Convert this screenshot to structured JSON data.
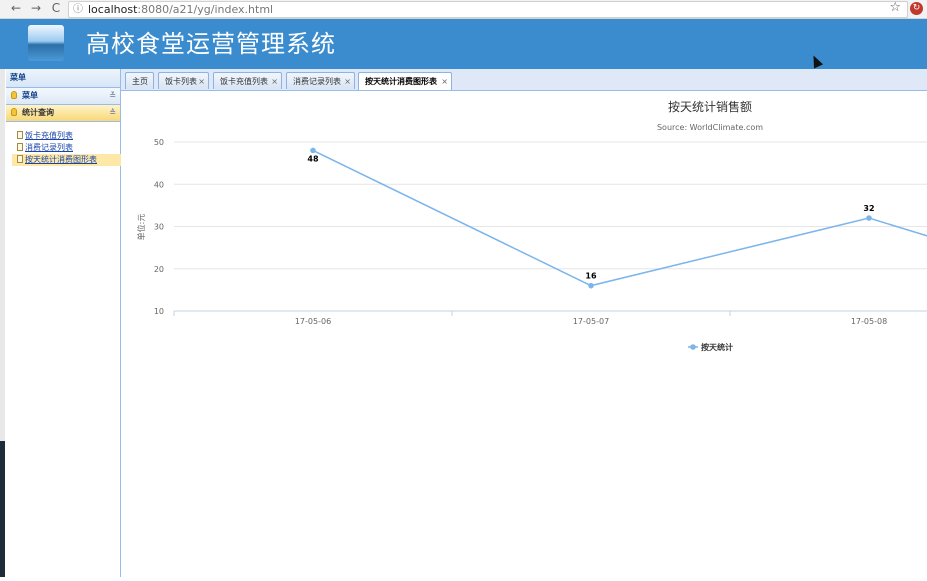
{
  "browser": {
    "url_host": "localhost",
    "url_path": ":8080/a21/yg/index.html",
    "back_icon": "←",
    "forward_icon": "→",
    "reload_icon": "C",
    "info_icon": "ⓘ",
    "star_icon": "☆",
    "ext_icon": "↻"
  },
  "app": {
    "title": "高校食堂运营管理系统"
  },
  "sidebar": {
    "title": "菜单",
    "sections": [
      {
        "label": "菜单"
      },
      {
        "label": "统计查询"
      }
    ],
    "expand_icon": "≚",
    "collapse_icon": "≙",
    "items": [
      {
        "label": "饭卡充值列表"
      },
      {
        "label": "消费记录列表"
      },
      {
        "label": "按天统计消费图形表"
      }
    ]
  },
  "tabs": [
    {
      "label": "主页",
      "closable": false
    },
    {
      "label": "饭卡列表",
      "closable": true
    },
    {
      "label": "饭卡充值列表",
      "closable": true
    },
    {
      "label": "消费记录列表",
      "closable": true
    },
    {
      "label": "按天统计消费图形表",
      "closable": true,
      "active": true
    }
  ],
  "close_glyph": "×",
  "chart_data": {
    "type": "line",
    "title": "按天统计销售额",
    "subtitle": "Source: WorldClimate.com",
    "ylabel": "单位:元",
    "xlabel": "",
    "categories": [
      "17-05-06",
      "17-05-07",
      "17-05-08"
    ],
    "series": [
      {
        "name": "按天统计",
        "values": [
          48,
          16,
          32
        ],
        "color": "#7cb5ec"
      }
    ],
    "ylim": [
      10,
      50
    ],
    "yticks": [
      10,
      20,
      30,
      40,
      50
    ],
    "grid": true,
    "legend": "bottom-center"
  }
}
